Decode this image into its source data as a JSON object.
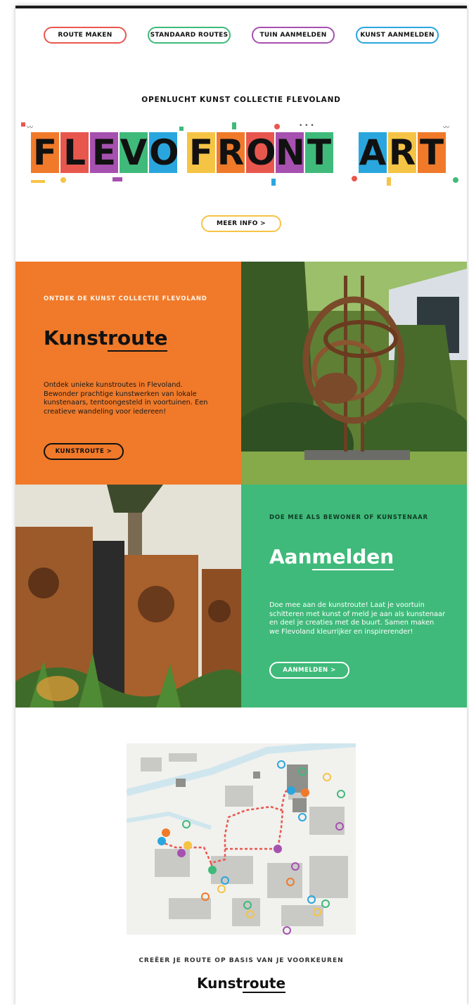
{
  "nav": {
    "items": [
      {
        "label": "ROUTE MAKEN",
        "color": "#e8574e"
      },
      {
        "label": "STANDAARD ROUTES",
        "color": "#3fba7a"
      },
      {
        "label": "TUIN AANMELDEN",
        "color": "#a651b0"
      },
      {
        "label": "KUNST AANMELDEN",
        "color": "#2aa6de"
      }
    ]
  },
  "hero": {
    "headline": "OPENLUCHT KUNST COLLECTIE FLEVOLAND",
    "logo_words": [
      "FLEVO",
      "FRONT",
      "ART"
    ],
    "logo_colors": [
      "#f07a2a",
      "#e8574e",
      "#a651b0",
      "#3fba7a",
      "#2aa6de",
      "#f6c445"
    ],
    "button_label": "MEER INFO >",
    "button_color": "#f6c445"
  },
  "kunstroute": {
    "kicker": "ONTDEK DE KUNST COLLECTIE FLEVOLAND",
    "title_plain": "Kunst",
    "title_underlined": "route",
    "body": "Ontdek unieke kunstroutes in Flevoland. Bewonder prachtige kunstwerken van lokale kunstenaars, tentoongesteld in voortuinen. Een creatieve wandeling voor iedereen!",
    "button_label": "KUNSTROUTE >",
    "bg_color": "#f07a2a"
  },
  "aanmelden": {
    "kicker": "DOE MEE ALS BEWONER OF KUNSTENAAR",
    "title_plain": "Aan",
    "title_underlined": "melden",
    "body": "Doe mee aan de kunstroute! Laat je voortuin schitteren met kunst of meld je aan als kunstenaar en deel je creaties met de buurt. Samen maken we Flevoland kleurrijker en inspirerender!",
    "button_label": "AANMELDEN >",
    "bg_color": "#3fba7a"
  },
  "footer": {
    "kicker": "CREËER JE ROUTE OP BASIS VAN JE VOORKEUREN",
    "title_plain": "Kunst",
    "title_underlined": "route"
  }
}
